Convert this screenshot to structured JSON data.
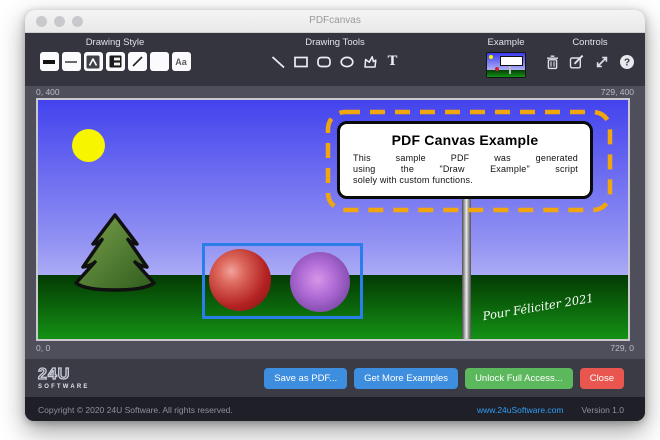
{
  "window": {
    "title": "PDFcanvas"
  },
  "toolbar": {
    "groups": {
      "drawing_style": "Drawing Style",
      "drawing_tools": "Drawing Tools",
      "example": "Example",
      "controls": "Controls"
    },
    "style": {
      "text_style_label": "Aa"
    },
    "tools": {
      "text_tool_label": "T"
    }
  },
  "canvas": {
    "coordinates": {
      "top_left": "0, 400",
      "top_right": "729, 400",
      "bottom_left": "0, 0",
      "bottom_right": "729, 0"
    },
    "sign": {
      "title": "PDF Canvas Example",
      "body_lines": [
        "This sample PDF was generated",
        "using the \"Draw Example\" script",
        "solely with custom functions."
      ]
    },
    "greeting": "Pour Féliciter 2021"
  },
  "actions": {
    "save_pdf": "Save as PDF...",
    "more_examples": "Get More Examples",
    "unlock": "Unlock Full Access...",
    "close": "Close"
  },
  "branding": {
    "name": "24U",
    "subtitle": "SOFTWARE"
  },
  "footer": {
    "copyright": "Copyright © 2020 24U Software. All rights reserved.",
    "website": "www.24uSoftware.com",
    "version": "Version 1.0"
  },
  "colors": {
    "selection_dash": "#F2A60D",
    "selection_rect": "#2B7DE9",
    "save_button": "#3E8EE0",
    "unlock_button": "#5CB85C",
    "close_button": "#E8564F",
    "link": "#2F9DF5",
    "sky_top": "#4343EE",
    "sky_bottom": "#DADAF9",
    "ground_top": "#033A03",
    "ground_bottom": "#149114",
    "sun": "#F7F500"
  }
}
